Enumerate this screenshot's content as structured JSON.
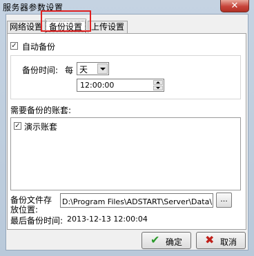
{
  "window": {
    "title": "服务器参数设置",
    "close_glyph": "✕"
  },
  "tabs": [
    {
      "label": "网络设置"
    },
    {
      "label": "备份设置"
    },
    {
      "label": "上传设置"
    }
  ],
  "backup": {
    "auto_backup_label": "自动备份",
    "auto_backup_checked": true,
    "check_glyph": "✓",
    "time_label": "备份时间:",
    "every_label": "每",
    "period_value": "天",
    "time_value": "12:00:00",
    "accounts_label": "需要备份的账套:",
    "accounts": [
      {
        "name": "演示账套",
        "checked": true
      }
    ],
    "path_label_line1": "备份文件存",
    "path_label_line2": "放位置:",
    "path_value": "D:\\Program Files\\ADSTART\\Server\\Data\\自动备份",
    "browse_label": "...",
    "last_backup_label": "最后备份时间:",
    "last_backup_value": "2013-12-13 12:00:04"
  },
  "buttons": {
    "ok_label": "确定",
    "cancel_label": "取消",
    "ok_icon": "✔",
    "cancel_icon": "✖"
  },
  "colors": {
    "highlight_box": "#e02020",
    "ok_icon": "#2a9a2a",
    "cancel_icon": "#c0201a"
  }
}
